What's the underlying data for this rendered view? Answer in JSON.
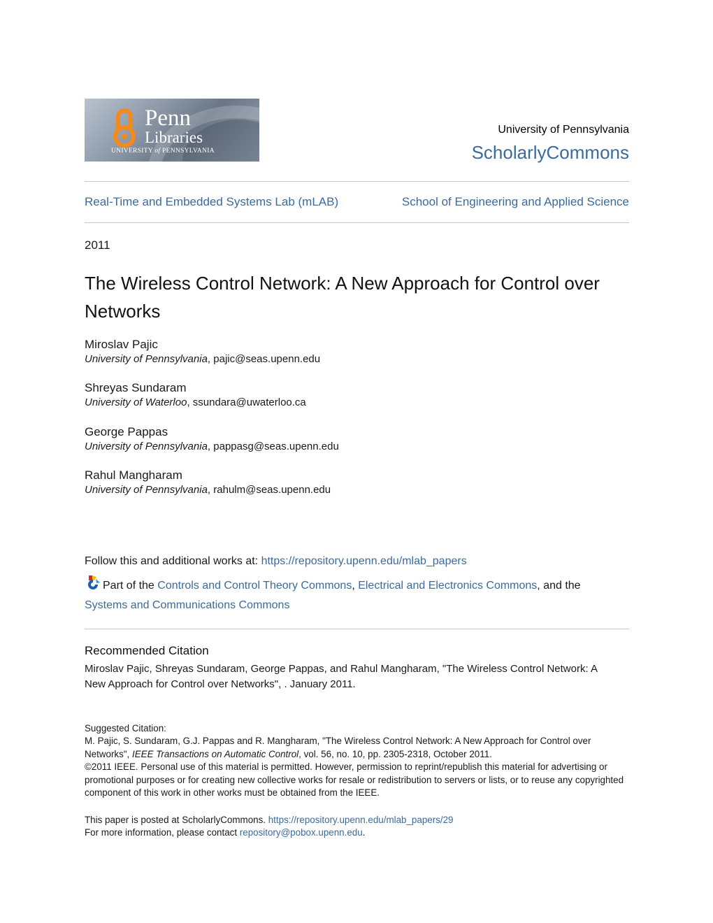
{
  "header": {
    "logo": {
      "brand": "Penn",
      "subbrand": "Libraries",
      "institution_line": "University of Pennsylvania",
      "accent_color": "#f28a1d"
    },
    "institution": "University of Pennsylvania",
    "repository": "ScholarlyCommons",
    "link_color": "#3b6a9c"
  },
  "breadcrumbs": {
    "department": "Real-Time and Embedded Systems Lab (mLAB)",
    "school": "School of Engineering and Applied Science"
  },
  "year": "2011",
  "title": "The Wireless Control Network: A New Approach for Control over Networks",
  "authors": [
    {
      "name": "Miroslav Pajic",
      "affiliation": "University of Pennsylvania",
      "email": "pajic@seas.upenn.edu"
    },
    {
      "name": "Shreyas Sundaram",
      "affiliation": "University of Waterloo",
      "email": "ssundara@uwaterloo.ca"
    },
    {
      "name": "George Pappas",
      "affiliation": "University of Pennsylvania",
      "email": "pappasg@seas.upenn.edu"
    },
    {
      "name": "Rahul Mangharam",
      "affiliation": "University of Pennsylvania",
      "email": "rahulm@seas.upenn.edu"
    }
  ],
  "follow": {
    "label": "Follow this and additional works at: ",
    "url": "https://repository.upenn.edu/mlab_papers"
  },
  "part_of": {
    "icon": "bepress-commons-icon",
    "prefix": "Part of the ",
    "links": [
      "Controls and Control Theory Commons",
      "Electrical and Electronics Commons",
      "Systems and Communications Commons"
    ],
    "sep": ", ",
    "and_the": ", and the"
  },
  "recommended_citation": {
    "heading": "Recommended Citation",
    "text": "Miroslav Pajic, Shreyas Sundaram, George Pappas, and Rahul Mangharam, \"The Wireless Control Network: A New Approach for Control over Networks\", . January 2011."
  },
  "suggested_citation": {
    "label": "Suggested Citation:",
    "line_a": "M. Pajic, S. Sundaram, G.J. Pappas and R. Mangharam, \"The Wireless Control Network: A New Approach for Control over Networks\", ",
    "journal": "IEEE Transactions on Automatic Control",
    "line_b": ", vol. 56, no. 10, pp. 2305-2318, October 2011.",
    "copyright": "©2011 IEEE. Personal use of this material is permitted. However, permission to reprint/republish this material for advertising or promotional purposes or for creating new collective works for resale or redistribution to servers or lists, or to reuse any copyrighted component of this work in other works must be obtained from the IEEE."
  },
  "posted": {
    "prefix": "This paper is posted at ScholarlyCommons. ",
    "url": "https://repository.upenn.edu/mlab_papers/29",
    "contact_prefix": "For more information, please contact ",
    "contact_email": "repository@pobox.upenn.edu",
    "contact_suffix": "."
  }
}
